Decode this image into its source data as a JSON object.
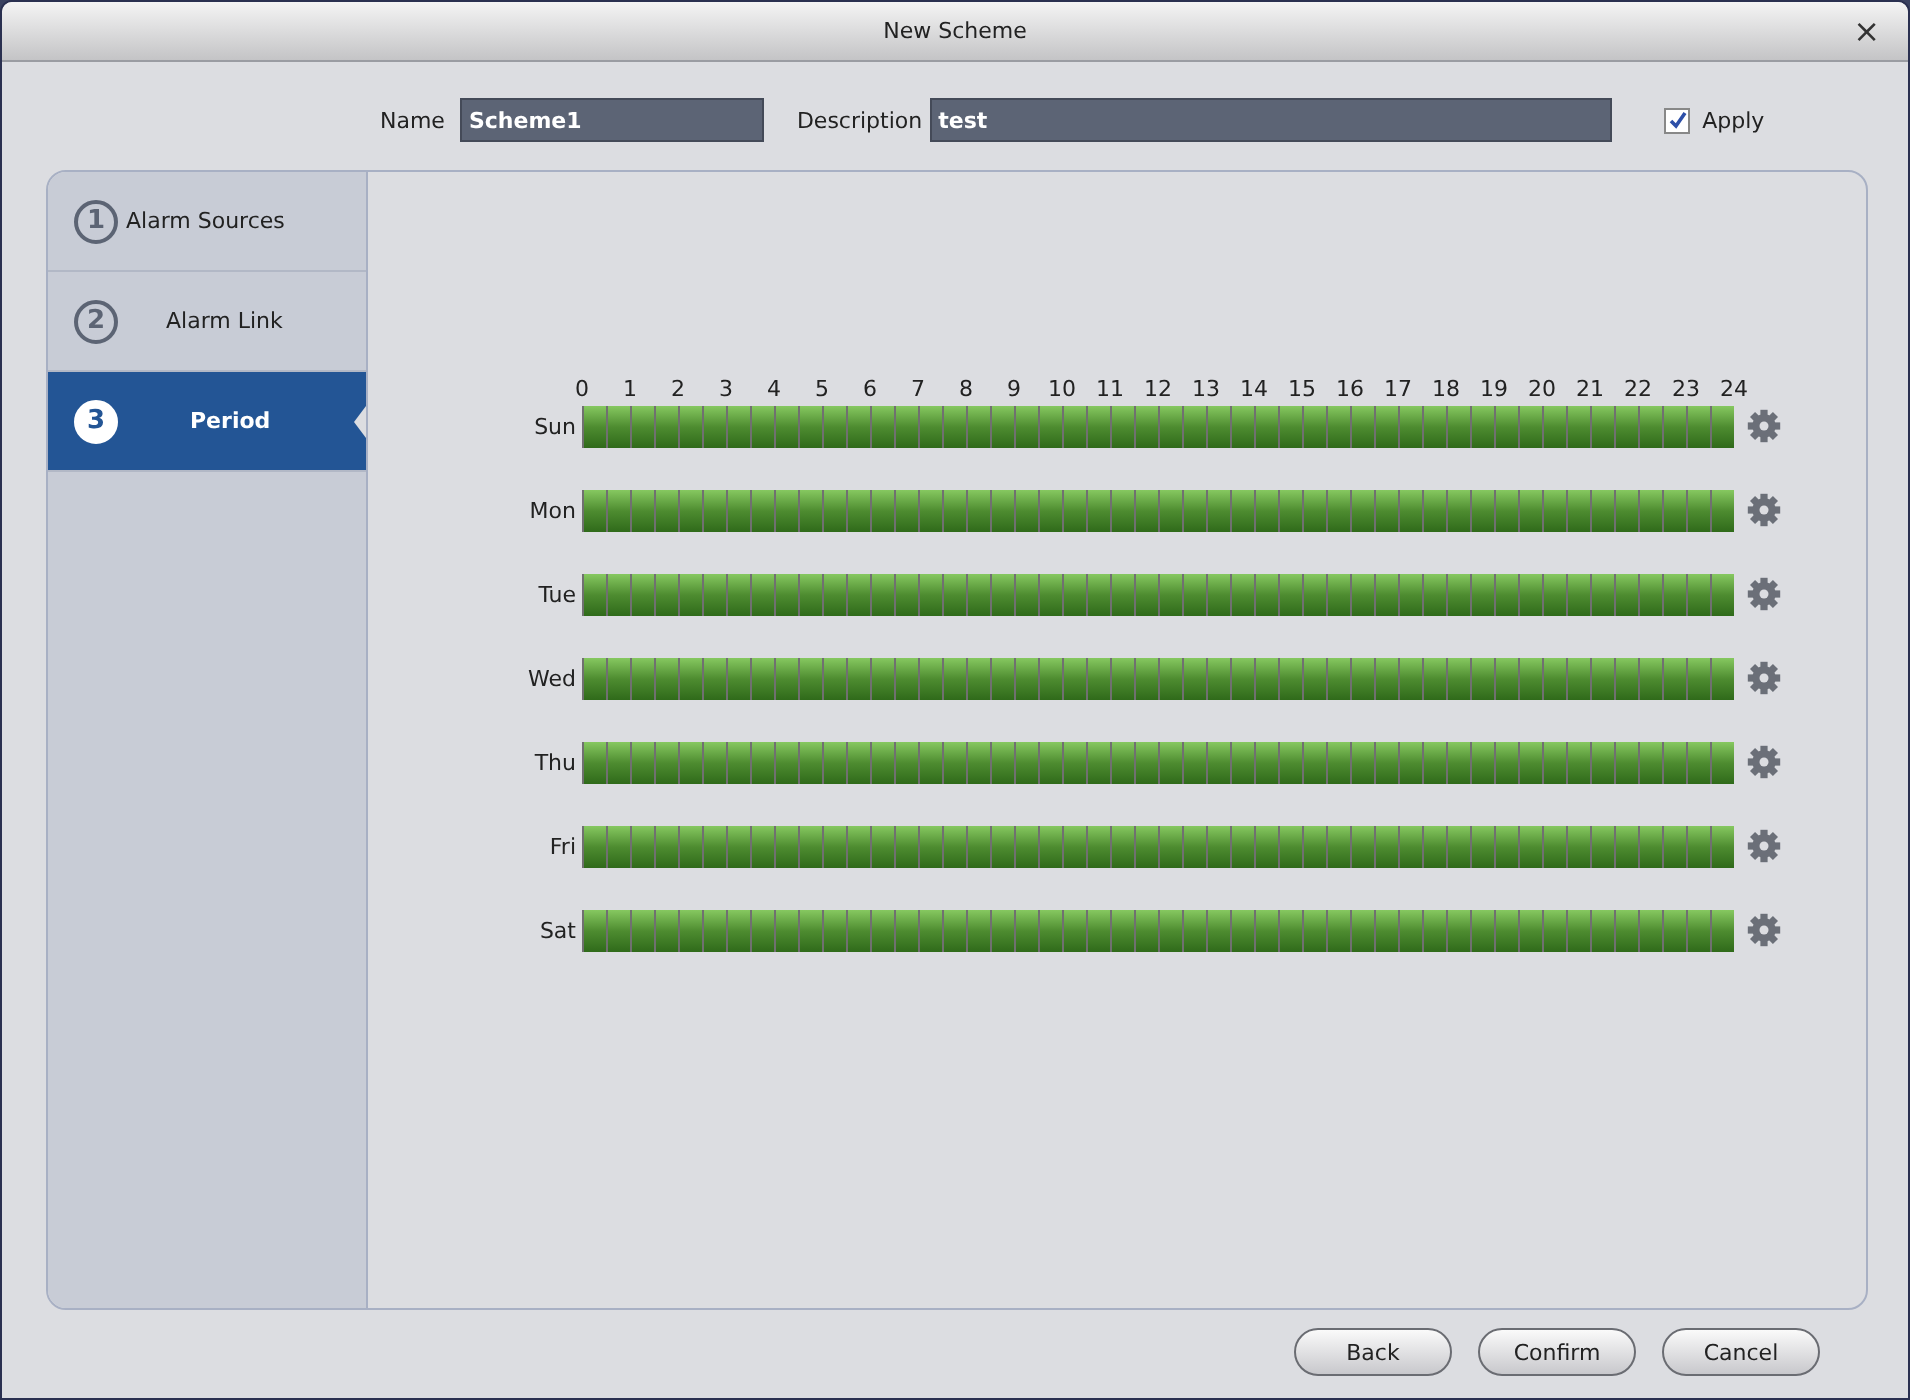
{
  "window": {
    "title": "New Scheme",
    "close": "×"
  },
  "form": {
    "name_label": "Name",
    "name_value": "Scheme1",
    "description_label": "Description",
    "description_value": "test",
    "apply": {
      "label": "Apply",
      "checked": true
    }
  },
  "steps": [
    {
      "number": "1",
      "label": "Alarm Sources",
      "selected": false
    },
    {
      "number": "2",
      "label": "Alarm Link",
      "selected": false
    },
    {
      "number": "3",
      "label": "Period",
      "selected": true
    }
  ],
  "hours": [
    "0",
    "1",
    "2",
    "3",
    "4",
    "5",
    "6",
    "7",
    "8",
    "9",
    "10",
    "11",
    "12",
    "13",
    "14",
    "15",
    "16",
    "17",
    "18",
    "19",
    "20",
    "21",
    "22",
    "23",
    "24"
  ],
  "days": [
    {
      "label": "Sun",
      "level": 1
    },
    {
      "label": "Mon",
      "level": 1
    },
    {
      "label": "Tue",
      "level": 1
    },
    {
      "label": "Wed",
      "level": 1
    },
    {
      "label": "Thu",
      "level": 1
    },
    {
      "label": "Fri",
      "level": 1
    },
    {
      "label": "Sat",
      "level": 1
    }
  ],
  "buttons": [
    "Back",
    "Confirm",
    "Cancel"
  ]
}
